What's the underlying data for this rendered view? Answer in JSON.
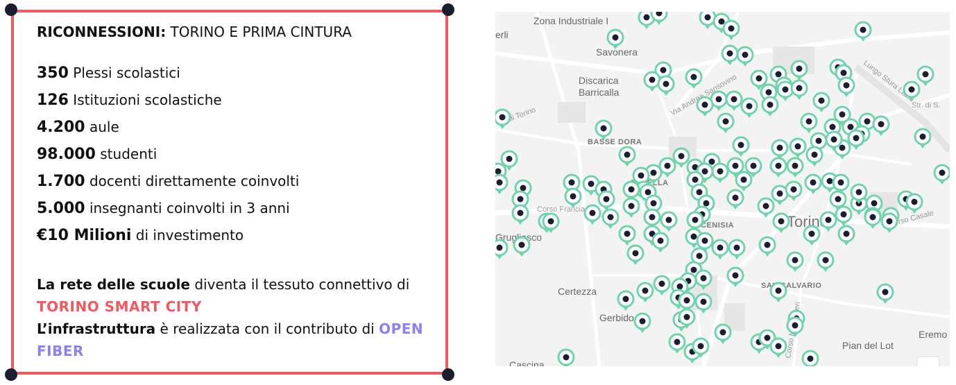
{
  "card": {
    "heading_bold": "RICONNESSIONI:",
    "heading_rest": " TORINO E PRIMA CINTURA",
    "stats": [
      {
        "num": "350",
        "txt": " Plessi scolastici"
      },
      {
        "num": "126",
        "txt": " Istituzioni scolastiche"
      },
      {
        "num": "4.200",
        "txt": " aule"
      },
      {
        "num": "98.000",
        "txt": " studenti"
      },
      {
        "num": "1.700",
        "txt": " docenti direttamente coinvolti"
      },
      {
        "num": "5.000",
        "txt": " insegnanti coinvolti in 3 anni"
      },
      {
        "num": "€10 Milioni",
        "txt": " di investimento"
      }
    ],
    "p1_bold": "La rete delle scuole",
    "p1_rest": " diventa il tessuto connettivo di ",
    "p1_highlight": "TORINO SMART CITY",
    "p2_bold": "L’infrastruttura",
    "p2_rest": " è realizzata con il contributo di ",
    "p2_highlight": "OPEN FIBER",
    "colors": {
      "frame": "#f0595f",
      "corner": "#1b1e2e",
      "highlight_red": "#f0595f",
      "highlight_purple": "#8a82f4"
    }
  },
  "map": {
    "labels": {
      "zona_industriale": "Zona Industriale I",
      "savonera": "Savonera",
      "discarica": "Discarica",
      "barricalla": "Barricalla",
      "basse_dora": "BASSE DORA",
      "parella": "PARELLA",
      "cenisia": "CENISIA",
      "torino": "Torino",
      "grugliasco": "Grugliasco",
      "certezza": "Certezza",
      "gerbido": "Gerbido",
      "san_salvario": "SAN SALVARIO",
      "pian_del_lot": "Pian del Lot",
      "eremo": "Eremo",
      "corso_casale": "Corso Casale",
      "lungo_stura": "Lungo Stura Lazio",
      "via_andrea": "Via Andrea Sansovino",
      "corso_francia": "Corso Francia",
      "corso_moncalieri": "Corso Moncalieri",
      "strada": "Str. di S.",
      "di_torino": "di Torino",
      "erli": "erli",
      "cascina": "Cascina"
    },
    "pin_colors": {
      "ring": "#6fd4ab",
      "dot": "#1b1e2e"
    }
  }
}
